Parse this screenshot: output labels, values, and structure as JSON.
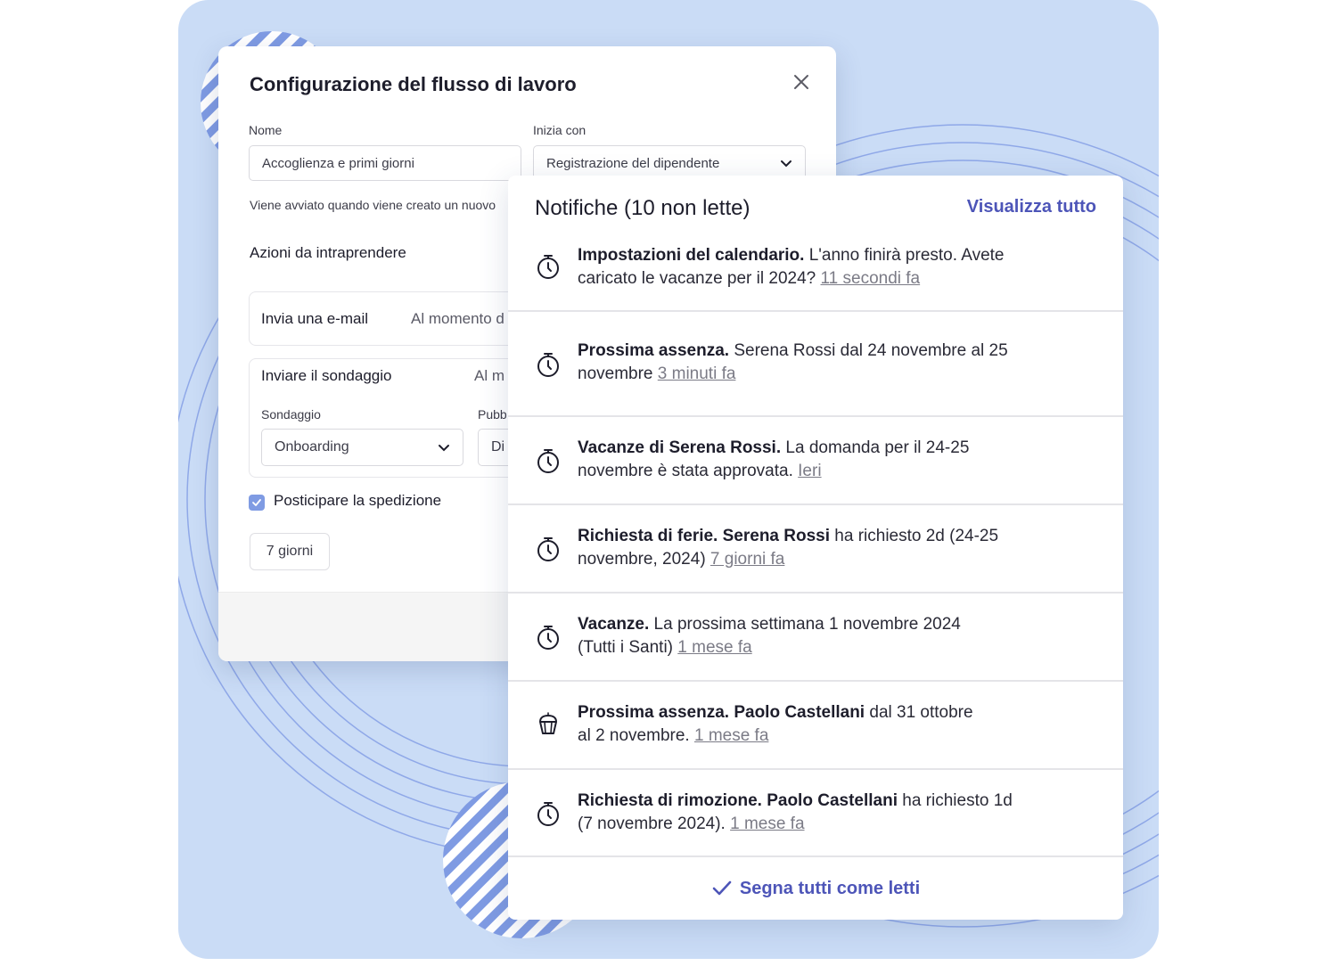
{
  "colors": {
    "background_panel": "#cadcf6",
    "accent": "#4d55b8",
    "stripe": "#7f9be3",
    "checkbox": "#7f9be3"
  },
  "workflow": {
    "title": "Configurazione del flusso di lavoro",
    "name_label": "Nome",
    "name_value": "Accoglienza e primi giorni",
    "starts_label": "Inizia con",
    "starts_value": "Registrazione del dipendente",
    "helper_text": "Viene avviato quando viene creato un nuovo",
    "actions_title": "Azioni da intraprendere",
    "action_email": {
      "title": "Invia una e-mail",
      "when": "Al momento d"
    },
    "action_survey": {
      "title": "Inviare il sondaggio",
      "when": "Al m",
      "survey_label": "Sondaggio",
      "survey_value": "Onboarding",
      "publish_label": "Pubb",
      "publish_value": "Di"
    },
    "postpone_label": "Posticipare la spedizione",
    "postpone_checked": true,
    "delay_value": "7 giorni"
  },
  "notifications": {
    "title": "Notifiche (10 non lette)",
    "view_all": "Visualizza tutto",
    "mark_all_read": "Segna tutti come letti",
    "items": [
      {
        "icon": "stopwatch-icon",
        "bold": "Impostazioni del calendario.",
        "line1_rest": " L'anno finirà presto. Avete",
        "line2": "caricato le vacanze per il 2024? ",
        "time": "11 secondi fa"
      },
      {
        "icon": "stopwatch-icon",
        "bold": "Prossima assenza.",
        "line1_rest": " Serena Rossi dal 24 novembre al 25",
        "line2": "novembre ",
        "time": "3 minuti fa"
      },
      {
        "icon": "stopwatch-icon",
        "bold": "Vacanze di Serena Rossi.",
        "line1_rest": " La domanda per il 24-25",
        "line2": "novembre è stata approvata. ",
        "time": "Ieri"
      },
      {
        "icon": "stopwatch-icon",
        "bold": "Richiesta di ferie. Serena Rossi",
        "line1_rest": " ha richiesto 2d (24-25",
        "line2": "novembre, 2024) ",
        "time": "7 giorni fa"
      },
      {
        "icon": "stopwatch-icon",
        "bold": "Vacanze.",
        "line1_rest": " La prossima settimana 1 novembre 2024",
        "line2": "(Tutti i Santi) ",
        "time": "1 mese fa"
      },
      {
        "icon": "cupcake-icon",
        "bold": "Prossima assenza. Paolo Castellani",
        "line1_rest": " dal 31 ottobre",
        "line2": "al 2 novembre. ",
        "time": "1 mese fa"
      },
      {
        "icon": "stopwatch-icon",
        "bold": "Richiesta di rimozione. Paolo Castellani",
        "line1_rest": " ha richiesto 1d",
        "line2": "(7 novembre 2024). ",
        "time": "1 mese fa"
      }
    ]
  }
}
